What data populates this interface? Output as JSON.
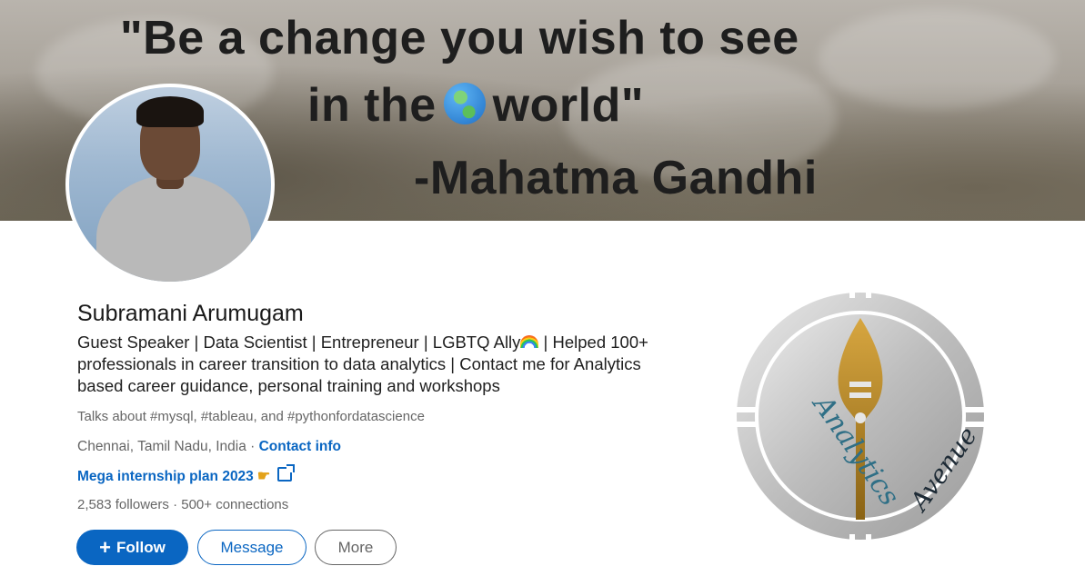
{
  "banner": {
    "line1": "\"Be a change you wish to see",
    "line2_before": "in the",
    "line2_after": "world\"",
    "line3": "-Mahatma Gandhi",
    "globe_icon": "earth-americas-icon"
  },
  "profile": {
    "name": "Subramani Arumugam",
    "headline_before": "Guest Speaker | Data Scientist | Entrepreneur | LGBTQ Ally",
    "headline_after": " | Helped 100+ professionals in career transition to data analytics | Contact me for Analytics based career guidance, personal training and workshops",
    "talks_about": "Talks about #mysql, #tableau, and #pythonfordatascience",
    "location": "Chennai, Tamil Nadu, India",
    "separator": " · ",
    "contact_info": "Contact info",
    "link_text": "Mega internship plan 2023",
    "followers": "2,583 followers",
    "stats_separator": " · ",
    "connections": "500+ connections"
  },
  "actions": {
    "follow_plus": "+",
    "follow_label": "Follow",
    "message_label": "Message",
    "more_label": "More"
  },
  "company_logo": {
    "text_left": "Analytics",
    "text_right": "Avenue"
  },
  "colors": {
    "accent": "#0a66c2",
    "muted_text": "#666666",
    "primary_text": "#191919"
  }
}
